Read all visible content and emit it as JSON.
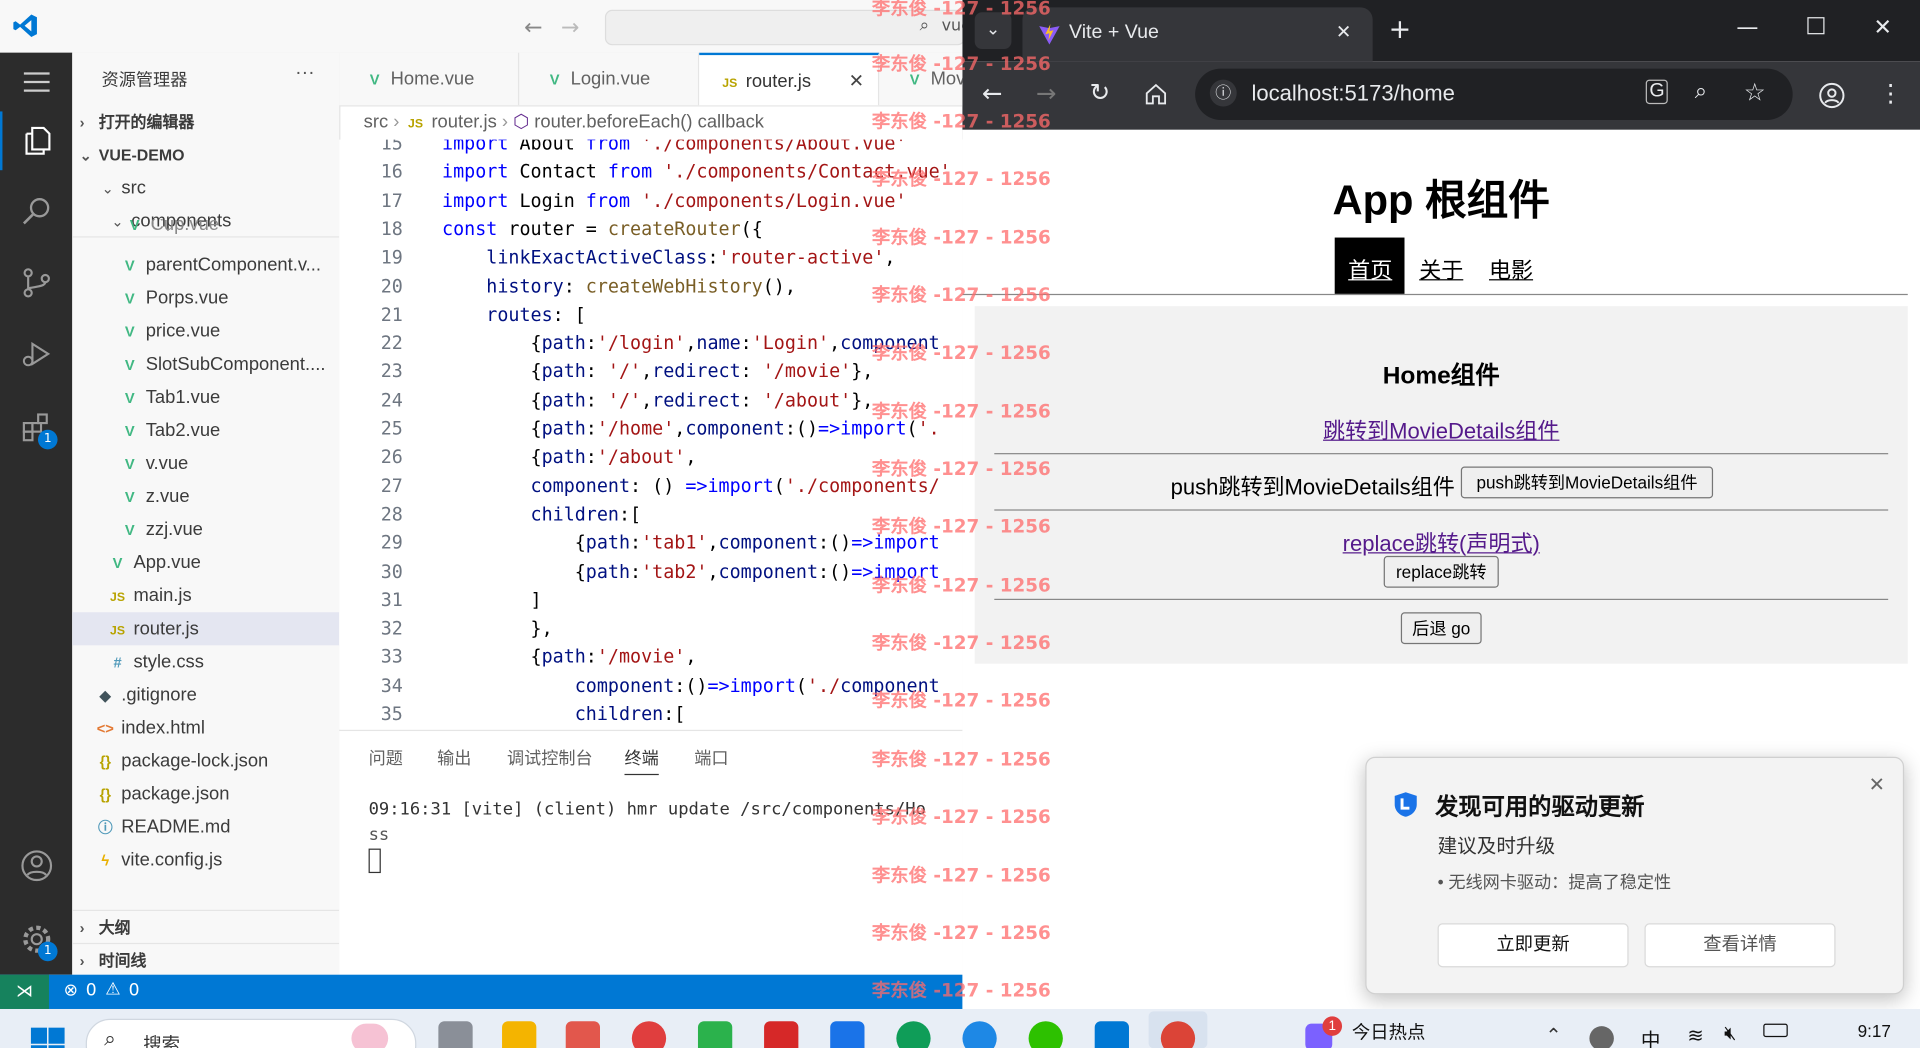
{
  "vscode": {
    "title_search": "vue-demo",
    "explorer_title": "资源管理器",
    "open_editors_label": "打开的编辑器",
    "project_label": "VUE-DEMO",
    "activity_badges": {
      "extensions": "1",
      "settings": "1"
    },
    "tree": [
      {
        "label": "src",
        "kind": "folder"
      },
      {
        "label": "components",
        "kind": "folder"
      },
      {
        "label": "Cup.vue",
        "kind": "vue"
      },
      {
        "label": "parentComponent.v...",
        "kind": "vue"
      },
      {
        "label": "Porps.vue",
        "kind": "vue"
      },
      {
        "label": "price.vue",
        "kind": "vue"
      },
      {
        "label": "SlotSubComponent....",
        "kind": "vue"
      },
      {
        "label": "Tab1.vue",
        "kind": "vue"
      },
      {
        "label": "Tab2.vue",
        "kind": "vue"
      },
      {
        "label": "v.vue",
        "kind": "vue"
      },
      {
        "label": "z.vue",
        "kind": "vue"
      },
      {
        "label": "zzj.vue",
        "kind": "vue"
      },
      {
        "label": "App.vue",
        "kind": "vue"
      },
      {
        "label": "main.js",
        "kind": "js"
      },
      {
        "label": "router.js",
        "kind": "js"
      },
      {
        "label": "style.css",
        "kind": "css"
      },
      {
        "label": ".gitignore",
        "kind": "git"
      },
      {
        "label": "index.html",
        "kind": "html"
      },
      {
        "label": "package-lock.json",
        "kind": "json"
      },
      {
        "label": "package.json",
        "kind": "json"
      },
      {
        "label": "README.md",
        "kind": "md"
      },
      {
        "label": "vite.config.js",
        "kind": "vite"
      }
    ],
    "outline_label": "大纲",
    "timeline_label": "时间线",
    "tabs": [
      {
        "label": "Home.vue",
        "icon": "vue"
      },
      {
        "label": "Login.vue",
        "icon": "vue"
      },
      {
        "label": "router.js",
        "icon": "js",
        "active": true
      },
      {
        "label": "Mov",
        "icon": "vue"
      }
    ],
    "breadcrumb": [
      "src",
      "router.js",
      "router.beforeEach() callback"
    ],
    "code_lines": [
      {
        "n": "15",
        "t": "import About from './components/About.vue'"
      },
      {
        "n": "16",
        "t": "import Contact from './components/Contact.vue'"
      },
      {
        "n": "17",
        "t": "import Login from './components/Login.vue'"
      },
      {
        "n": "18",
        "t": "const router = createRouter({"
      },
      {
        "n": "19",
        "t": "    linkExactActiveClass:'router-active',"
      },
      {
        "n": "20",
        "t": "    history: createWebHistory(),"
      },
      {
        "n": "21",
        "t": "    routes: ["
      },
      {
        "n": "22",
        "t": "        {path:'/login',name:'Login',component"
      },
      {
        "n": "23",
        "t": "        {path: '/',redirect: '/movie'},"
      },
      {
        "n": "24",
        "t": "        {path: '/',redirect: '/about'},"
      },
      {
        "n": "25",
        "t": "        {path:'/home',component:()=>import('."
      },
      {
        "n": "26",
        "t": "        {path:'/about',"
      },
      {
        "n": "27",
        "t": "        component: () =>import('./components/"
      },
      {
        "n": "28",
        "t": "        children:["
      },
      {
        "n": "29",
        "t": "            {path:'tab1',component:()=>import"
      },
      {
        "n": "30",
        "t": "            {path:'tab2',component:()=>import"
      },
      {
        "n": "31",
        "t": "        ]"
      },
      {
        "n": "32",
        "t": "        },"
      },
      {
        "n": "33",
        "t": "        {path:'/movie',"
      },
      {
        "n": "34",
        "t": "            component:()=>import('./component"
      },
      {
        "n": "35",
        "t": "            children:["
      }
    ],
    "panel_tabs": [
      "问题",
      "输出",
      "调试控制台",
      "终端",
      "端口"
    ],
    "terminal_line1": "09:16:31 [vite] (client) hmr update /src/components/Ho",
    "terminal_line2": "ss",
    "status_errors": "0",
    "status_warnings": "0"
  },
  "browser": {
    "tab_title": "Vite + Vue",
    "url": "localhost:5173/home",
    "app_title": "App 根组件",
    "nav": [
      "首页",
      "关于",
      "电影"
    ],
    "home_title": "Home组件",
    "link1": "跳转到MovieDetails组件",
    "push_text": "push跳转到MovieDetails组件",
    "push_button": "push跳转到MovieDetails组件",
    "replace_link": "replace跳转(声明式)",
    "replace_button": "replace跳转",
    "back_button": "后退 go"
  },
  "watermark": "李东俊 -127 - 1256",
  "notification": {
    "title": "发现可用的驱动更新",
    "subtitle": "建议及时升级",
    "detail": "• 无线网卡驱动：提高了稳定性",
    "update_button": "立即更新",
    "details_button": "查看详情"
  },
  "taskbar": {
    "search_placeholder": "搜索",
    "hot_label": "今日热点",
    "hot_badge": "1",
    "ime": "中",
    "clock": "9:17"
  },
  "colors": {
    "vscode_accent": "#0078d4",
    "vue_green": "#41b883",
    "watermark": "#ff6b6b"
  }
}
